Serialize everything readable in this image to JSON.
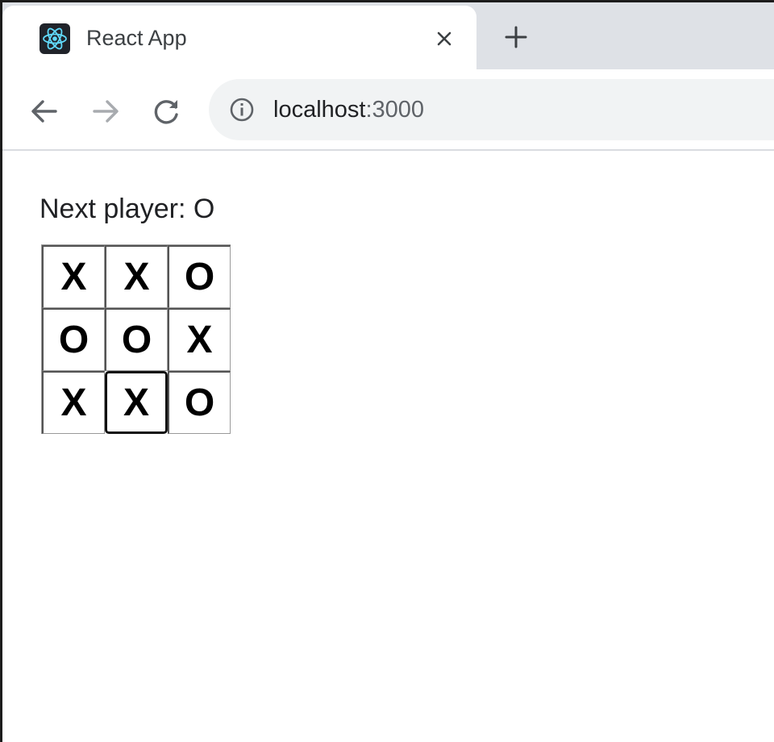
{
  "browser": {
    "tab": {
      "title": "React App",
      "favicon": "react-logo-icon",
      "close_icon": "close-icon"
    },
    "new_tab_icon": "plus-icon",
    "nav": {
      "back_icon": "back-arrow-icon",
      "forward_icon": "forward-arrow-icon",
      "reload_icon": "reload-icon"
    },
    "address_bar": {
      "security_icon": "info-icon",
      "host": "localhost",
      "port": ":3000"
    }
  },
  "game": {
    "status": "Next player: O",
    "board": [
      [
        "X",
        "X",
        "O"
      ],
      [
        "O",
        "O",
        "X"
      ],
      [
        "X",
        "X",
        "O"
      ]
    ]
  },
  "colors": {
    "tabstrip": "#dee1e6",
    "omnibox": "#f1f3f4",
    "react_logo": "#61dafb",
    "square_border": "#999999"
  }
}
